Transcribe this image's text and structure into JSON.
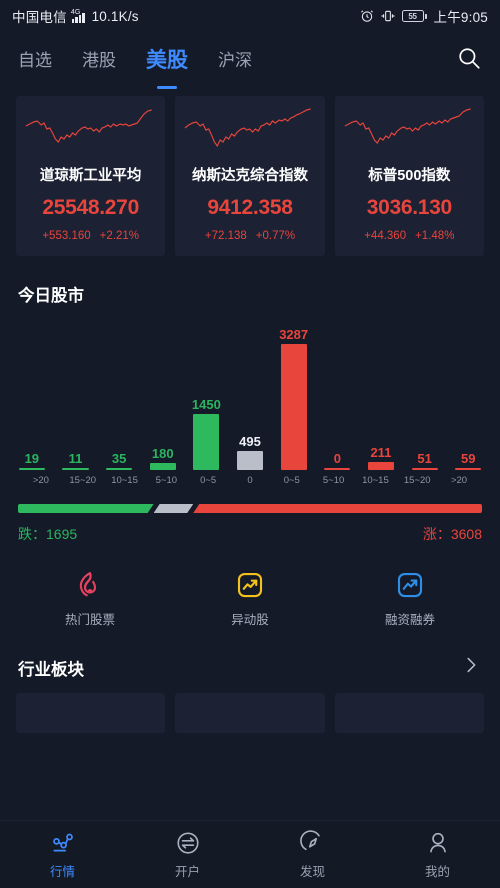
{
  "status_bar": {
    "carrier": "中国电信",
    "network_type": "4G",
    "network_icon": "signal-bars-icon",
    "speed": "10.1K/s",
    "alarm_icon": "alarm-clock-icon",
    "vibrate_icon": "vibrate-icon",
    "battery_level": "55",
    "battery_icon": "battery-icon",
    "time": "上午9:05"
  },
  "top_tabs": {
    "items": [
      {
        "label": "自选",
        "active": false
      },
      {
        "label": "港股",
        "active": false
      },
      {
        "label": "美股",
        "active": true
      },
      {
        "label": "沪深",
        "active": false
      }
    ],
    "search_icon": "search-icon"
  },
  "index_cards": [
    {
      "name": "道琼斯工业平均",
      "value": "25548.270",
      "change": "+553.160",
      "change_pct": "+2.21%",
      "color": "#e8453c"
    },
    {
      "name": "纳斯达克综合指数",
      "value": "9412.358",
      "change": "+72.138",
      "change_pct": "+0.77%",
      "color": "#e8453c"
    },
    {
      "name": "标普500指数",
      "value": "3036.130",
      "change": "+44.360",
      "change_pct": "+1.48%",
      "color": "#e8453c"
    }
  ],
  "today_market": {
    "title": "今日股市",
    "down_label": "跌：1695",
    "up_label": "涨：3608",
    "down_count": 1695,
    "flat_count": 495,
    "up_count": 3608
  },
  "chart_data": {
    "type": "bar",
    "title": "今日股市",
    "xlabel": "",
    "ylabel": "",
    "ylim": [
      0,
      3287
    ],
    "grid": false,
    "legend": "none",
    "categories": [
      ">20",
      "15~20",
      "10~15",
      "5~10",
      "0~5",
      "0",
      "0~5",
      "5~10",
      "10~15",
      "15~20",
      ">20"
    ],
    "values": [
      19,
      11,
      35,
      180,
      1450,
      495,
      3287,
      0,
      211,
      51,
      59
    ],
    "bar_colors": [
      "#2eb95f",
      "#2eb95f",
      "#2eb95f",
      "#2eb95f",
      "#2eb95f",
      "#b9bec8",
      "#e8453c",
      "#e8453c",
      "#e8453c",
      "#e8453c",
      "#e8453c"
    ],
    "groups": [
      "down",
      "down",
      "down",
      "down",
      "down",
      "flat",
      "up",
      "up",
      "up",
      "up",
      "up"
    ],
    "data_labels": [
      "19",
      "11",
      "35",
      "180",
      "1450",
      "495",
      "3287",
      "0",
      "211",
      "51",
      "59"
    ]
  },
  "shortcuts": [
    {
      "label": "热门股票",
      "icon": "flame-icon",
      "color": "#e8415e"
    },
    {
      "label": "异动股",
      "icon": "trending-square-icon",
      "color": "#f2c11c"
    },
    {
      "label": "融资融券",
      "icon": "arrow-up-square-icon",
      "color": "#2f8fe8"
    }
  ],
  "sectors": {
    "title": "行业板块",
    "chevron_icon": "chevron-right-icon",
    "cards": [
      "",
      "",
      ""
    ]
  },
  "bottom_nav": [
    {
      "label": "行情",
      "icon": "network-nodes-icon",
      "active": true
    },
    {
      "label": "开户",
      "icon": "exchange-arrows-icon",
      "active": false
    },
    {
      "label": "发现",
      "icon": "compass-icon",
      "active": false
    },
    {
      "label": "我的",
      "icon": "person-icon",
      "active": false
    }
  ],
  "theme": {
    "background": "#151a28",
    "card_background": "#1c2133",
    "accent_blue": "#3d8bff",
    "up_red": "#e8453c",
    "down_green": "#2eb95f",
    "flat_gray": "#b9bec8"
  }
}
